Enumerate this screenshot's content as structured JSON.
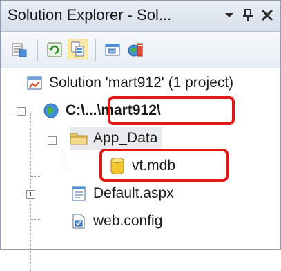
{
  "window": {
    "title": "Solution Explorer - Sol...",
    "dropdown_icon": "chevron-down-icon",
    "pin_icon": "pin-icon",
    "close_icon": "close-icon"
  },
  "toolbar": {
    "items": [
      {
        "name": "properties-icon"
      },
      {
        "name": "refresh-icon"
      },
      {
        "name": "show-all-files-icon"
      },
      {
        "name": "view-designer-icon"
      },
      {
        "name": "copy-website-icon"
      }
    ]
  },
  "tree": {
    "solution": "Solution 'mart912' (1 project)",
    "project": "C:\\...\\mart912\\",
    "app_data": "App_Data",
    "db_file": "vt.mdb",
    "default_page": "Default.aspx",
    "web_config": "web.config"
  },
  "colors": {
    "highlight": "#e01818",
    "selection": "#e8eaee"
  }
}
